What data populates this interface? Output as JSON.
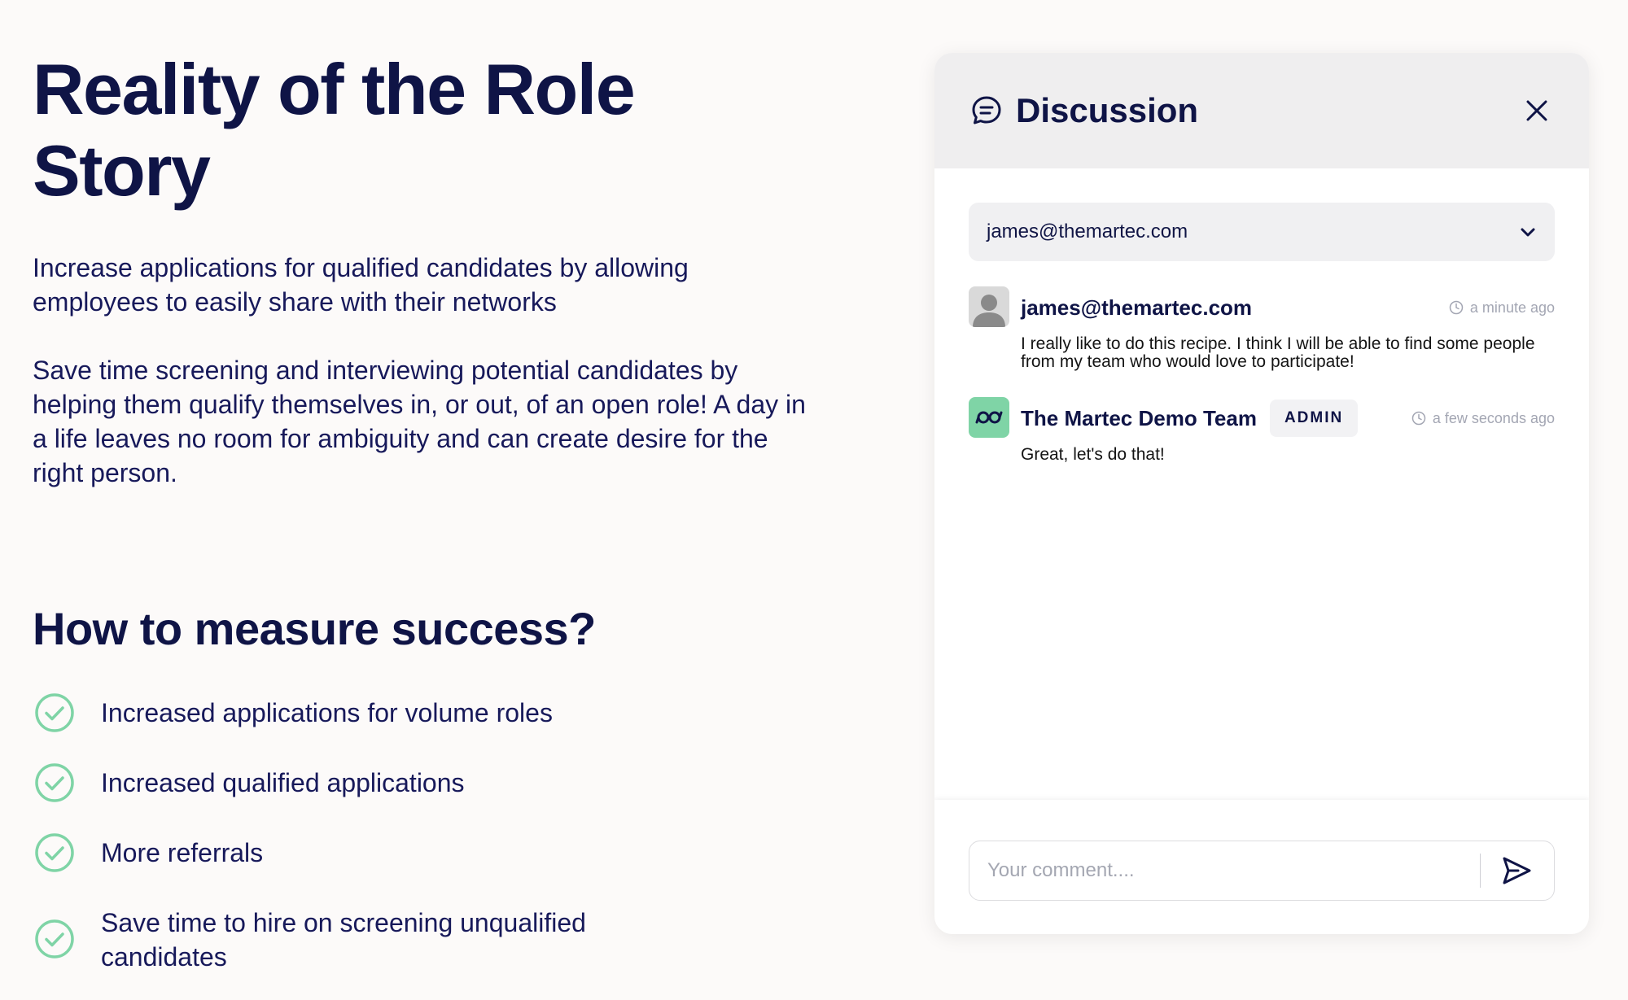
{
  "content": {
    "title": "Reality of the Role Story",
    "paragraphs": [
      "Increase applications for qualified candidates by allowing employees to easily share with their networks",
      "Save time screening and interviewing potential candidates by helping them qualify themselves in, or out, of an open role! A day in a life leaves no room for ambiguity and can create desire for the right person."
    ],
    "success_heading": "How to measure success?",
    "success_items": [
      "Increased applications for volume roles",
      "Increased qualified applications",
      "More referrals",
      "Save time to hire on screening unqualified candidates"
    ]
  },
  "discussion": {
    "title": "Discussion",
    "icon": "chat-bubble-icon",
    "selected_user": "james@themartec.com",
    "comments": [
      {
        "author": "james@themartec.com",
        "badge": "",
        "time": "a minute ago",
        "body": "I really like to do this recipe. I think I will be able to find some people from my team who would love to participate!"
      },
      {
        "author": "The Martec Demo Team",
        "badge": "ADMIN",
        "time": "a few seconds ago",
        "body": "Great, let's do that!"
      }
    ],
    "comment_placeholder": "Your comment...."
  },
  "colors": {
    "navy": "#0f1446",
    "check_green": "#7fd4a6",
    "page_bg": "#fcfaf9",
    "panel_header_bg": "#efeeef"
  }
}
